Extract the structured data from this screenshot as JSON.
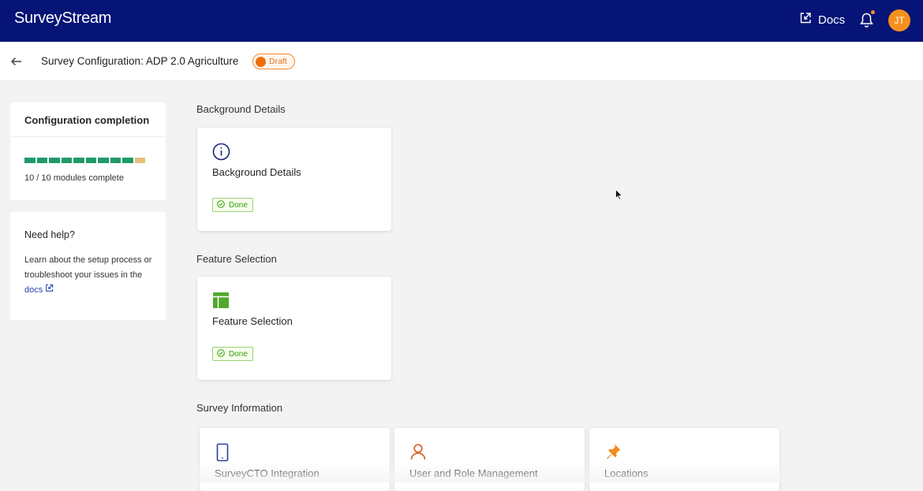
{
  "app": {
    "brand": "SurveyStream",
    "docs_label": "Docs",
    "avatar_initials": "JT",
    "accent_color": "#051476",
    "avatar_color": "#f5901f"
  },
  "subheader": {
    "title": "Survey Configuration: ADP 2.0 Agriculture",
    "status_badge": "Draft"
  },
  "sidebar": {
    "completion": {
      "title": "Configuration completion",
      "modules_text": "10 / 10 modules complete",
      "progress_completed": 10,
      "progress_total": 10
    },
    "help": {
      "title": "Need help?",
      "text": "Learn about the setup process or troubleshoot your issues in the",
      "docs_link": "docs"
    }
  },
  "sections": [
    {
      "heading": "Background Details",
      "cards": [
        {
          "title": "Background Details",
          "icon": "info-circle-icon",
          "status": "Done"
        }
      ]
    },
    {
      "heading": "Feature Selection",
      "cards": [
        {
          "title": "Feature Selection",
          "icon": "layout-icon",
          "status": "Done"
        }
      ]
    },
    {
      "heading": "Survey Information",
      "cards": [
        {
          "title": "SurveyCTO Integration",
          "icon": "mobile-icon"
        },
        {
          "title": "User and Role Management",
          "icon": "user-icon"
        },
        {
          "title": "Locations",
          "icon": "pushpin-icon"
        }
      ]
    }
  ],
  "colors": {
    "done_green": "#389e0d",
    "draft_orange": "#ec6f0d",
    "progress_green": "#1f9a6a",
    "progress_pending": "#e4c07b"
  }
}
